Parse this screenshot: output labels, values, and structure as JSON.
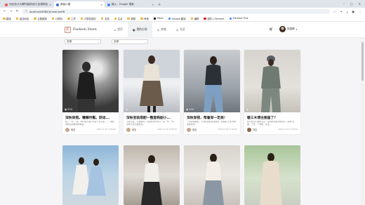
{
  "browser": {
    "tabs": [
      {
        "title": "创业设计大赛时装线设计/全报网站",
        "active": false,
        "color": "#e95f5f"
      },
      {
        "title": "服装小屋",
        "active": true,
        "color": "#4d7bd6"
      },
      {
        "title": "输入 - Google 搜索",
        "active": false,
        "color": "#4285f4"
      }
    ],
    "url": "localhost:8080/#/user/outfit",
    "bookmarks": [
      {
        "label": "翻译",
        "icon": "bm"
      },
      {
        "label": "激活码店",
        "icon": "bm"
      },
      {
        "label": "云数据库",
        "icon": "bm"
      },
      {
        "label": "计算机",
        "icon": "bm"
      },
      {
        "label": "工作",
        "icon": "bm"
      },
      {
        "label": "计算机进阶",
        "icon": "bm"
      },
      {
        "label": "文档",
        "icon": "bm"
      },
      {
        "label": "生活",
        "icon": "bm"
      },
      {
        "label": "视频",
        "icon": "bm"
      },
      {
        "label": "其他",
        "icon": "bm"
      },
      {
        "label": "Mock",
        "icon": "k"
      },
      {
        "label": "Google 翻译",
        "icon": "g"
      },
      {
        "label": "编辑",
        "icon": "bm"
      },
      {
        "label": "组件 | Element",
        "icon": "r"
      },
      {
        "label": "Element Plus",
        "icon": "g"
      }
    ]
  },
  "app": {
    "logo_char": "F",
    "brand": "Fashion Store",
    "nav": [
      {
        "label": "首页",
        "icon": "home-icon",
        "glyph": "⌂",
        "active": false
      },
      {
        "label": "我的分享",
        "icon": "image-icon",
        "glyph": "▣",
        "active": true
      },
      {
        "label": "商城",
        "icon": "shop-icon",
        "glyph": "◎",
        "active": false
      },
      {
        "label": "社区",
        "icon": "community-icon",
        "glyph": "◎",
        "active": false
      }
    ],
    "user_name": "张嘉卿"
  },
  "filters": [
    {
      "value": "全部"
    },
    {
      "value": "全部"
    }
  ],
  "cards": [
    {
      "views": "953",
      "title": "深秋穿搭。慵懒时髦。舒适...",
      "desc": "我了一句：\"哇，你们是不是以为这个冬天来了...\"\n我找到秋冬时髦简约单品...",
      "author": "张嘉",
      "date": "2024-12-06 17:00:00"
    },
    {
      "views": "910",
      "title": "深秋变装搭配一整套韩剧小...",
      "desc": "不锐不贵，已透明性。包括棉穿才叫又一来，毕...\n你，穿着不花们是漂亮~",
      "author": "张嘉",
      "date": "2024-12-06 17:00:00"
    },
    {
      "views": "586",
      "title": "深秋穿搭，帮着穿一定美！",
      "desc": "一周穿搭模板，不我仕银的穿搭组合，挑挑标上给\n你的穿搭喜欢~",
      "author": "张嘉",
      "date": "2024-12-06 17:00:00"
    },
    {
      "views": "525",
      "title": "暖三木博主图鉴了？",
      "desc": "我们穿家们都的全身，双时的穿搭风格展示了各种\n衣服。工作、个呼唤、生活...",
      "author": "刘玉",
      "date": "2024-12-06 17:00:00"
    }
  ]
}
